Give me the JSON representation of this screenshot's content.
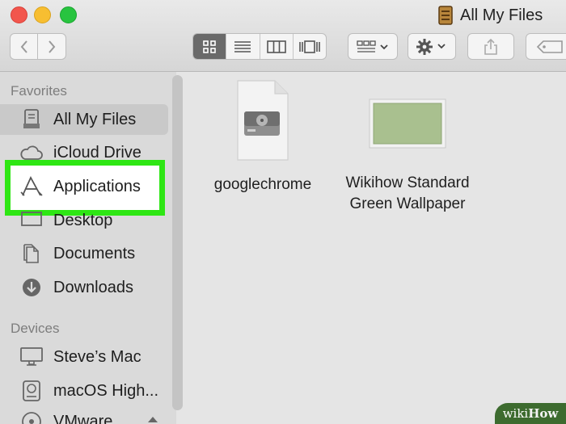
{
  "window": {
    "title": "All My Files"
  },
  "sidebar": {
    "favorites_header": "Favorites",
    "favorites": [
      {
        "label": "All My Files",
        "icon": "all-files-icon",
        "selected": true
      },
      {
        "label": "iCloud Drive",
        "icon": "cloud-icon"
      },
      {
        "label": "Applications",
        "icon": "applications-icon",
        "highlighted": true
      },
      {
        "label": "Desktop",
        "icon": "desktop-icon"
      },
      {
        "label": "Documents",
        "icon": "documents-icon"
      },
      {
        "label": "Downloads",
        "icon": "downloads-icon"
      }
    ],
    "devices_header": "Devices",
    "devices": [
      {
        "label": "Steve’s Mac",
        "icon": "computer-icon"
      },
      {
        "label": "macOS High...",
        "icon": "disk-icon"
      },
      {
        "label": "VMware",
        "icon": "disc-icon"
      }
    ]
  },
  "files": [
    {
      "name_lines": [
        "googlechrome"
      ],
      "icon": "disk-image-icon"
    },
    {
      "name_lines": [
        "Wikihow Standard",
        "Green Wallpaper"
      ],
      "icon": "image-thumbnail-icon",
      "thumb_color": "#a9c08f"
    }
  ],
  "colors": {
    "highlight": "#2ee614",
    "selection": "#c9c9c9"
  },
  "watermark": {
    "prefix": "wiki",
    "suffix": "How"
  }
}
